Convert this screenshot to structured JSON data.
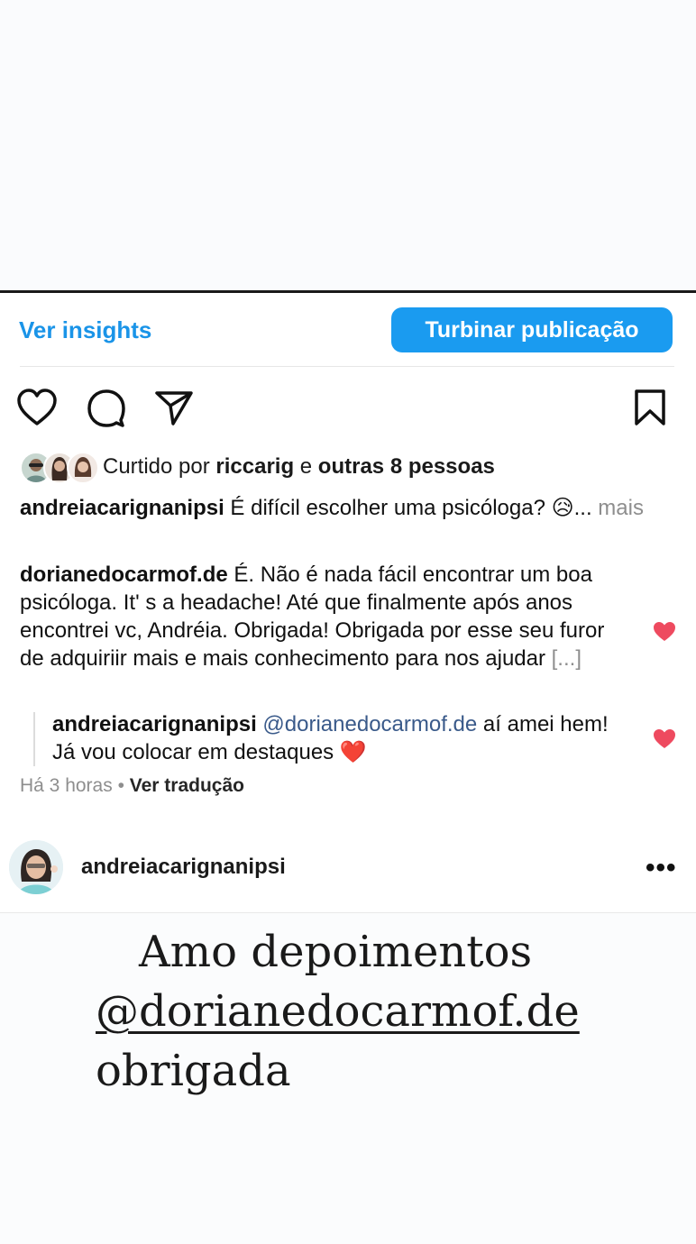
{
  "actions": {
    "insights_label": "Ver insights",
    "boost_label": "Turbinar publicação"
  },
  "icons": {
    "like": "heart-outline-icon",
    "comment": "comment-bubble-icon",
    "share": "send-icon",
    "save": "bookmark-icon",
    "comment_like": "heart-filled-icon"
  },
  "likes": {
    "prefix": "Curtido por ",
    "user": "riccarig",
    "joiner": " e ",
    "others": "outras 8 pessoas"
  },
  "caption": {
    "username": "andreiacarignanipsi",
    "text": " É difícil escolher uma psicóloga? 😥...",
    "more": " mais"
  },
  "comment": {
    "username": "dorianedocarmof.de",
    "text": " É. Não é nada fácil encontrar um boa psicóloga. It' s a headache! Até que finalmente após anos encontrei vc, Andréia. Obrigada! Obrigada por esse seu furor de adquiriir mais e mais conhecimento para nos ajudar ",
    "ellipsis": "[...]"
  },
  "reply": {
    "username": "andreiacarignanipsi",
    "mention": " @dorianedocarmof.de",
    "text": " aí amei hem! Já vou colocar em destaques ❤️"
  },
  "meta": {
    "time": "Há 3 horas",
    "separator": " • ",
    "translate": "Ver tradução"
  },
  "post": {
    "username": "andreiacarignanipsi",
    "more": "•••",
    "image_text": {
      "line1": "Amo depoimentos",
      "line2": "@dorianedocarmof.de",
      "line3": "obrigada"
    }
  },
  "colors": {
    "accent": "#1a9bf0",
    "link": "#1a94e8",
    "heart": "#ee4a5f",
    "muted": "#8e8e8e"
  }
}
